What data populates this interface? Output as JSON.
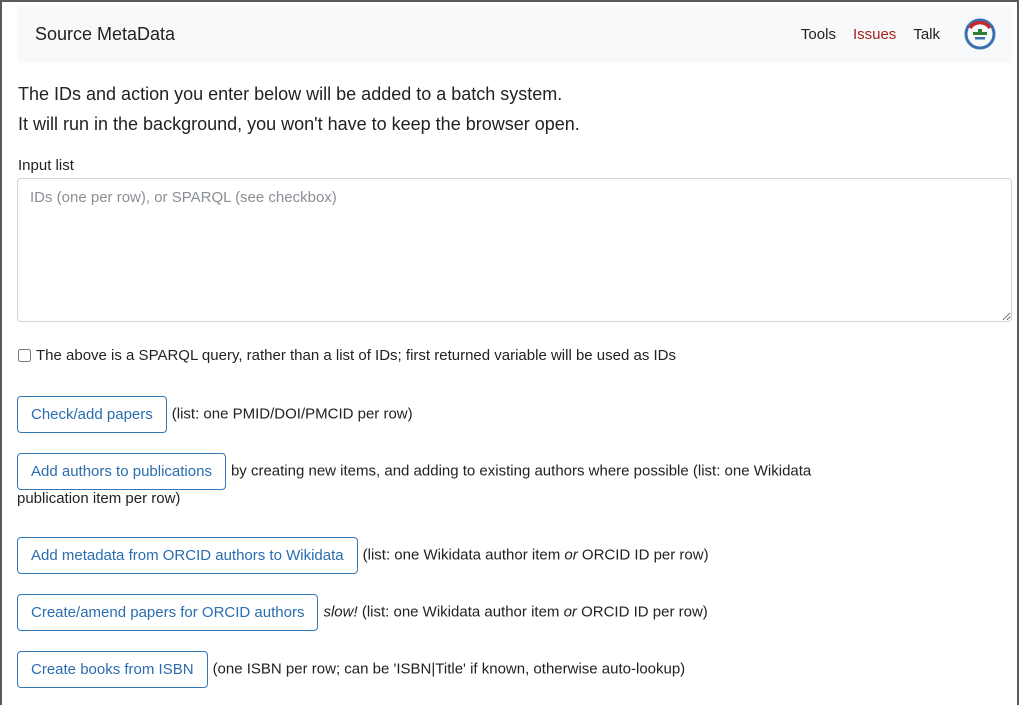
{
  "navbar": {
    "brand": "Source MetaData",
    "links": [
      "Tools",
      "Issues",
      "Talk"
    ],
    "logo_icon": "wikimedia-toolforge-logo",
    "issues_color": "#a8201a"
  },
  "intro": {
    "line1": "The IDs and action you enter below will be added to a batch system.",
    "line2": "It will run in the background, you won't have to keep the browser open."
  },
  "input": {
    "label": "Input list",
    "placeholder": "IDs (one per row), or SPARQL (see checkbox)",
    "value": ""
  },
  "sparql_checkbox": {
    "label": "The above is a SPARQL query, rather than a list of IDs; first returned variable will be used as IDs",
    "checked": false
  },
  "actions": [
    {
      "button": "Check/add papers",
      "desc": "(list: one PMID/DOI/PMCID per row)"
    },
    {
      "button": "Add authors to publications",
      "desc_a": "by creating new items, and adding to existing authors where possible (list: one Wikidata",
      "desc_b": "publication item per row)"
    },
    {
      "button": "Add metadata from ORCID authors to Wikidata",
      "desc_pre": "(list: one Wikidata author item ",
      "desc_em": "or",
      "desc_post": " ORCID ID per row)"
    },
    {
      "button": "Create/amend papers for ORCID authors",
      "desc_slow": "slow!",
      "desc_pre": " (list: one Wikidata author item ",
      "desc_em": "or",
      "desc_post": " ORCID ID per row)"
    },
    {
      "button": "Create books from ISBN",
      "desc": "(one ISBN per row; can be 'ISBN|Title' if known, otherwise auto-lookup)"
    }
  ],
  "colors": {
    "button_border": "#337ab7",
    "button_text": "#2a6db0",
    "navbar_bg": "#f8f9fa"
  }
}
